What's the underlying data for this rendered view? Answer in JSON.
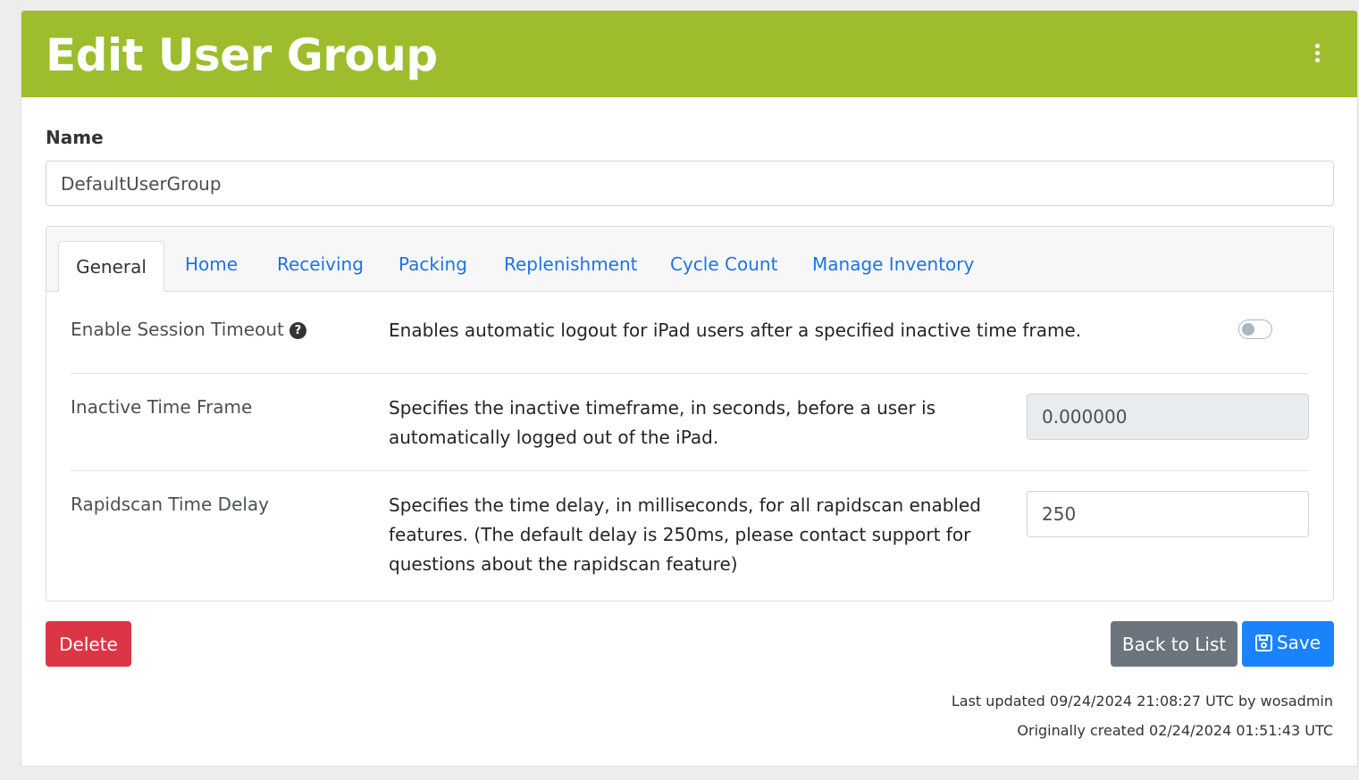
{
  "header": {
    "title": "Edit User Group",
    "color": "#9dbd2d",
    "menu_icon": "kebab-menu-icon"
  },
  "name_field": {
    "label": "Name",
    "value": "DefaultUserGroup"
  },
  "tabs": [
    {
      "label": "General",
      "active": true
    },
    {
      "label": "Home"
    },
    {
      "label": "Receiving"
    },
    {
      "label": "Packing"
    },
    {
      "label": "Replenishment"
    },
    {
      "label": "Cycle Count"
    },
    {
      "label": "Manage Inventory"
    }
  ],
  "settings": {
    "session_timeout": {
      "label": "Enable Session Timeout",
      "help_icon": "question-circle-icon",
      "help_glyph": "?",
      "description": "Enables automatic logout for iPad users after a specified inactive time frame.",
      "enabled": false
    },
    "inactive_time_frame": {
      "label": "Inactive Time Frame",
      "description_line1": "Specifies the inactive timeframe, in seconds, before a user is",
      "description_line2": "automatically logged out of the iPad.",
      "value": "0.000000",
      "disabled": true
    },
    "rapidscan_delay": {
      "label": "Rapidscan Time Delay",
      "description_line1": "Specifies the time delay, in milliseconds, for all rapidscan enabled",
      "description_line2": "features. (The default delay is 250ms, please contact support for",
      "description_line3": "questions about the rapidscan feature)",
      "value": "250"
    }
  },
  "actions": {
    "delete_label": "Delete",
    "back_label": "Back to List",
    "save_label": "Save",
    "save_icon": "floppy-disk-icon",
    "delete_color": "#dc3545",
    "back_color": "#6c757d",
    "save_color": "#1a82fb"
  },
  "meta": {
    "last_updated": "Last updated 09/24/2024 21:08:27 UTC by wosadmin",
    "created": "Originally created 02/24/2024 01:51:43 UTC"
  }
}
